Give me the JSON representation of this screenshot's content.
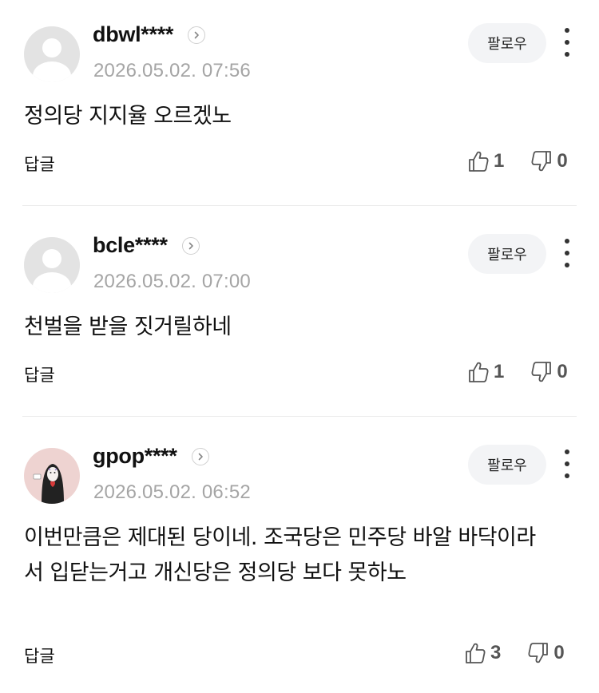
{
  "comments": [
    {
      "username": "dbwl****",
      "timestamp": "2026.05.02. 07:56",
      "follow_label": "팔로우",
      "text": "정의당 지지율 오르겠노",
      "reply_label": "답글",
      "likes": "1",
      "dislikes": "0",
      "avatar": "default-avatar-icon"
    },
    {
      "username": "bcle****",
      "timestamp": "2026.05.02. 07:00",
      "follow_label": "팔로우",
      "text": "천벌을 받을 짓거릴하네",
      "reply_label": "답글",
      "likes": "1",
      "dislikes": "0",
      "avatar": "default-avatar-icon"
    },
    {
      "username": "gpop****",
      "timestamp": "2026.05.02. 06:52",
      "follow_label": "팔로우",
      "text": "이번만큼은 제대된 당이네. 조국당은 민주당 바알 바닥이라서 입닫는거고 개신당은 정의당 보다 못하노",
      "reply_label": "답글",
      "likes": "3",
      "dislikes": "0",
      "avatar": "character-avatar-image"
    }
  ]
}
